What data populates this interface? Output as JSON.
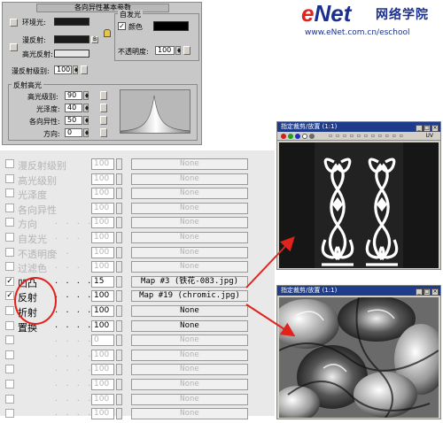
{
  "logo": {
    "brand_e": "e",
    "brand_rest": "Net",
    "brand_cn": "网络学院",
    "url": "www.eNet.com.cn/eschool"
  },
  "top_panel": {
    "title": "各向异性基本参数",
    "ambient_label": "环境光:",
    "diffuse_label": "漫反射:",
    "specular_label": "高光反射:",
    "self_illum_group": "自发光",
    "color_label": "颜色",
    "color_checked": true,
    "opacity_label": "不透明度:",
    "opacity_value": "100",
    "diffuse_level_label": "漫反射级别:",
    "diffuse_level_value": "100",
    "spec_group": "反射高光",
    "spec_level_label": "高光级别:",
    "spec_level_value": "90",
    "gloss_label": "光泽度:",
    "gloss_value": "40",
    "aniso_label": "各向异性:",
    "aniso_value": "50",
    "orient_label": "方向:",
    "orient_value": "0",
    "lock_button": "B",
    "ambient_color": "#1a1a1a",
    "diffuse_color": "#1a1a1a",
    "specular_color": "#e6e6e6",
    "self_illum_color": "#000000"
  },
  "maps": {
    "rows": [
      {
        "label": "漫反射级别",
        "dots": "",
        "amount": "100",
        "map": "None",
        "checked": false,
        "enabled": false
      },
      {
        "label": "高光级别",
        "dots": "",
        "amount": "100",
        "map": "None",
        "checked": false,
        "enabled": false
      },
      {
        "label": "光泽度",
        "dots": "",
        "amount": "100",
        "map": "None",
        "checked": false,
        "enabled": false
      },
      {
        "label": "各向异性",
        "dots": "",
        "amount": "100",
        "map": "None",
        "checked": false,
        "enabled": false
      },
      {
        "label": "方向",
        "dots": ". . . .",
        "amount": "100",
        "map": "None",
        "checked": false,
        "enabled": false
      },
      {
        "label": "自发光",
        "dots": ". . .",
        "amount": "100",
        "map": "None",
        "checked": false,
        "enabled": false
      },
      {
        "label": "不透明度",
        "dots": ". .",
        "amount": "100",
        "map": "None",
        "checked": false,
        "enabled": false
      },
      {
        "label": "过滤色",
        "dots": ". . .",
        "amount": "100",
        "map": "None",
        "checked": false,
        "enabled": false
      },
      {
        "label": "凹凸",
        "dots": ". . . .",
        "amount": "15",
        "map": "Map #3 (铁花-083.jpg)",
        "checked": true,
        "enabled": true
      },
      {
        "label": "反射",
        "dots": ". . . .",
        "amount": "100",
        "map": "Map #19 (chromic.jpg)",
        "checked": true,
        "enabled": true
      },
      {
        "label": "折射",
        "dots": ". . . .",
        "amount": "100",
        "map": "None",
        "checked": false,
        "enabled": true
      },
      {
        "label": "置换",
        "dots": ". . . .",
        "amount": "100",
        "map": "None",
        "checked": false,
        "enabled": true
      },
      {
        "label": "",
        "dots": ". . . . . .",
        "amount": "0",
        "map": "None",
        "checked": false,
        "enabled": false
      },
      {
        "label": "",
        "dots": ". . . . . .",
        "amount": "100",
        "map": "None",
        "checked": false,
        "enabled": false
      },
      {
        "label": "",
        "dots": ". . . . . .",
        "amount": "100",
        "map": "None",
        "checked": false,
        "enabled": false
      },
      {
        "label": "",
        "dots": ". . . . . .",
        "amount": "100",
        "map": "None",
        "checked": false,
        "enabled": false
      },
      {
        "label": "",
        "dots": ". . . . . .",
        "amount": "100",
        "map": "None",
        "checked": false,
        "enabled": false
      },
      {
        "label": "",
        "dots": ". . . . . .",
        "amount": "100",
        "map": "None",
        "checked": false,
        "enabled": false
      }
    ]
  },
  "window1": {
    "title": "指定裁剪/放置 (1:1)",
    "toolbar": "UV"
  },
  "window2": {
    "title": "指定裁剪/放置 (1:1)"
  },
  "colors": {
    "annotation": "#e0231c",
    "title_bar": "#1e3c8a"
  }
}
